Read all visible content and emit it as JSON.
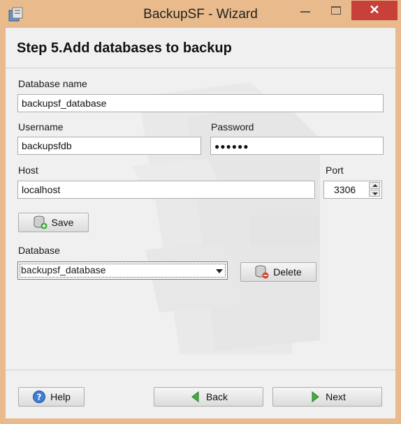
{
  "window": {
    "title": "BackupSF - Wizard",
    "close_glyph": "✕"
  },
  "header": {
    "title": "Step 5.Add databases to backup"
  },
  "form": {
    "db_name_label": "Database name",
    "db_name_value": "backupsf_database",
    "username_label": "Username",
    "username_value": "backupsfdb",
    "password_label": "Password",
    "password_value": "●●●●●●",
    "host_label": "Host",
    "host_value": "localhost",
    "port_label": "Port",
    "port_value": "3306",
    "save_label": "Save",
    "database_label": "Database",
    "database_selected": "backupsf_database",
    "delete_label": "Delete"
  },
  "footer": {
    "help_label": "Help",
    "back_label": "Back",
    "next_label": "Next"
  },
  "colors": {
    "titlebar": "#e9bb8c",
    "close": "#c7403a",
    "panel": "#f0f0f0"
  }
}
